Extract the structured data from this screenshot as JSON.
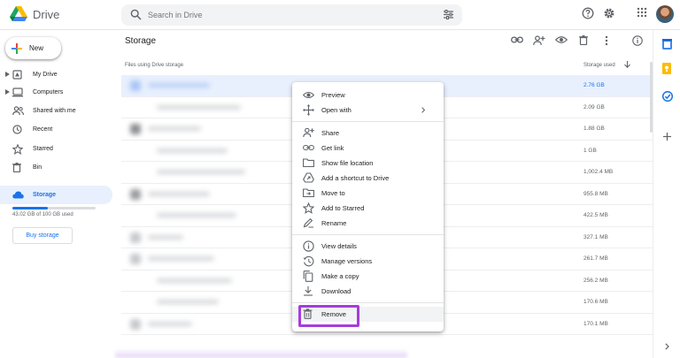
{
  "header": {
    "app_name": "Drive",
    "search_placeholder": "Search in Drive"
  },
  "sidebar": {
    "new_label": "New",
    "items": [
      {
        "label": "My Drive"
      },
      {
        "label": "Computers"
      },
      {
        "label": "Shared with me"
      },
      {
        "label": "Recent"
      },
      {
        "label": "Starred"
      },
      {
        "label": "Bin"
      },
      {
        "label": "Storage"
      }
    ],
    "storage_used_fraction": 0.43,
    "storage_text": "43.02 GB of 100 GB used",
    "buy_storage": "Buy storage"
  },
  "main": {
    "title": "Storage",
    "col_files": "Files using Drive storage",
    "col_storage": "Storage used",
    "rows": [
      {
        "size": "2.76 GB",
        "selected": true
      },
      {
        "size": "2.09 GB"
      },
      {
        "size": "1.88 GB"
      },
      {
        "size": "1 GB"
      },
      {
        "size": "1,002.4 MB"
      },
      {
        "size": "955.8 MB"
      },
      {
        "size": "422.5 MB"
      },
      {
        "size": "327.1 MB"
      },
      {
        "size": "261.7 MB"
      },
      {
        "size": "256.2 MB"
      },
      {
        "size": "170.6 MB"
      },
      {
        "size": "170.1 MB"
      }
    ]
  },
  "context_menu": {
    "preview": "Preview",
    "open_with": "Open with",
    "share": "Share",
    "get_link": "Get link",
    "show_location": "Show file location",
    "add_shortcut": "Add a shortcut to Drive",
    "move_to": "Move to",
    "add_starred": "Add to Starred",
    "rename": "Rename",
    "view_details": "View details",
    "manage_versions": "Manage versions",
    "make_copy": "Make a copy",
    "download": "Download",
    "remove": "Remove"
  },
  "colors": {
    "accent": "#1a73e8",
    "highlight_box": "#a63cdd",
    "selected_row": "#e8f0fe"
  }
}
